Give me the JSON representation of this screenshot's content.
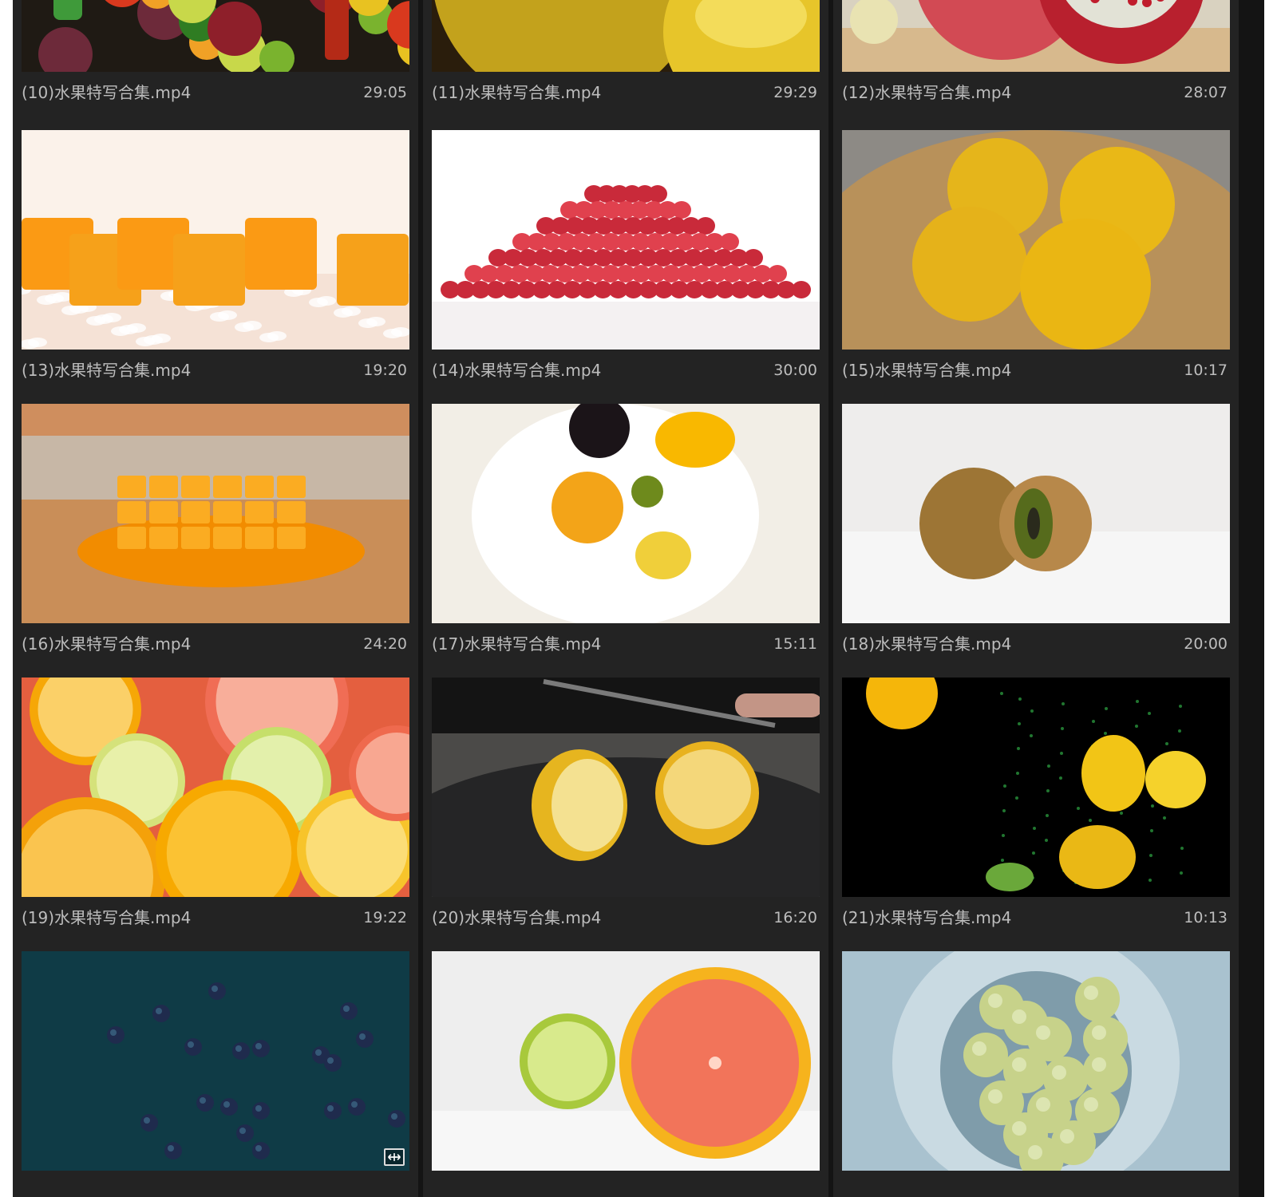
{
  "clips": [
    {
      "name": "(10)水果特写合集.mp4",
      "duration": "29:05",
      "scene": "assorted-fruit-top-view"
    },
    {
      "name": "(11)水果特写合集.mp4",
      "duration": "29:29",
      "scene": "citrus-closeup"
    },
    {
      "name": "(12)水果特写合集.mp4",
      "duration": "28:07",
      "scene": "pomegranate-on-board"
    },
    {
      "name": "(13)水果特写合集.mp4",
      "duration": "19:20",
      "scene": "mango-cubes"
    },
    {
      "name": "(14)水果特写合集.mp4",
      "duration": "30:00",
      "scene": "pomegranate-seeds"
    },
    {
      "name": "(15)水果特写合集.mp4",
      "duration": "10:17",
      "scene": "lemons-on-wood-plate"
    },
    {
      "name": "(16)水果特写合集.mp4",
      "duration": "24:20",
      "scene": "cut-mango-on-table"
    },
    {
      "name": "(17)水果特写合集.mp4",
      "duration": "15:11",
      "scene": "fruit-milk-splash"
    },
    {
      "name": "(18)水果特写合集.mp4",
      "duration": "20:00",
      "scene": "split-kiwi"
    },
    {
      "name": "(19)水果特写合集.mp4",
      "duration": "19:22",
      "scene": "citrus-slices"
    },
    {
      "name": "(20)水果特写合集.mp4",
      "duration": "16:20",
      "scene": "halved-lemon-knife"
    },
    {
      "name": "(21)水果特写合集.mp4",
      "duration": "10:13",
      "scene": "lemons-in-water-dark"
    },
    {
      "name": "",
      "duration": "",
      "scene": "blueberries-underwater",
      "badge_icon": "expand-arrows-icon"
    },
    {
      "name": "",
      "duration": "",
      "scene": "lime-and-grapefruit"
    },
    {
      "name": "",
      "duration": "",
      "scene": "grapes-in-blender"
    }
  ],
  "colors": {
    "panel_bg": "#141414",
    "cell_bg": "#232323",
    "text": "#bdbdbd"
  }
}
